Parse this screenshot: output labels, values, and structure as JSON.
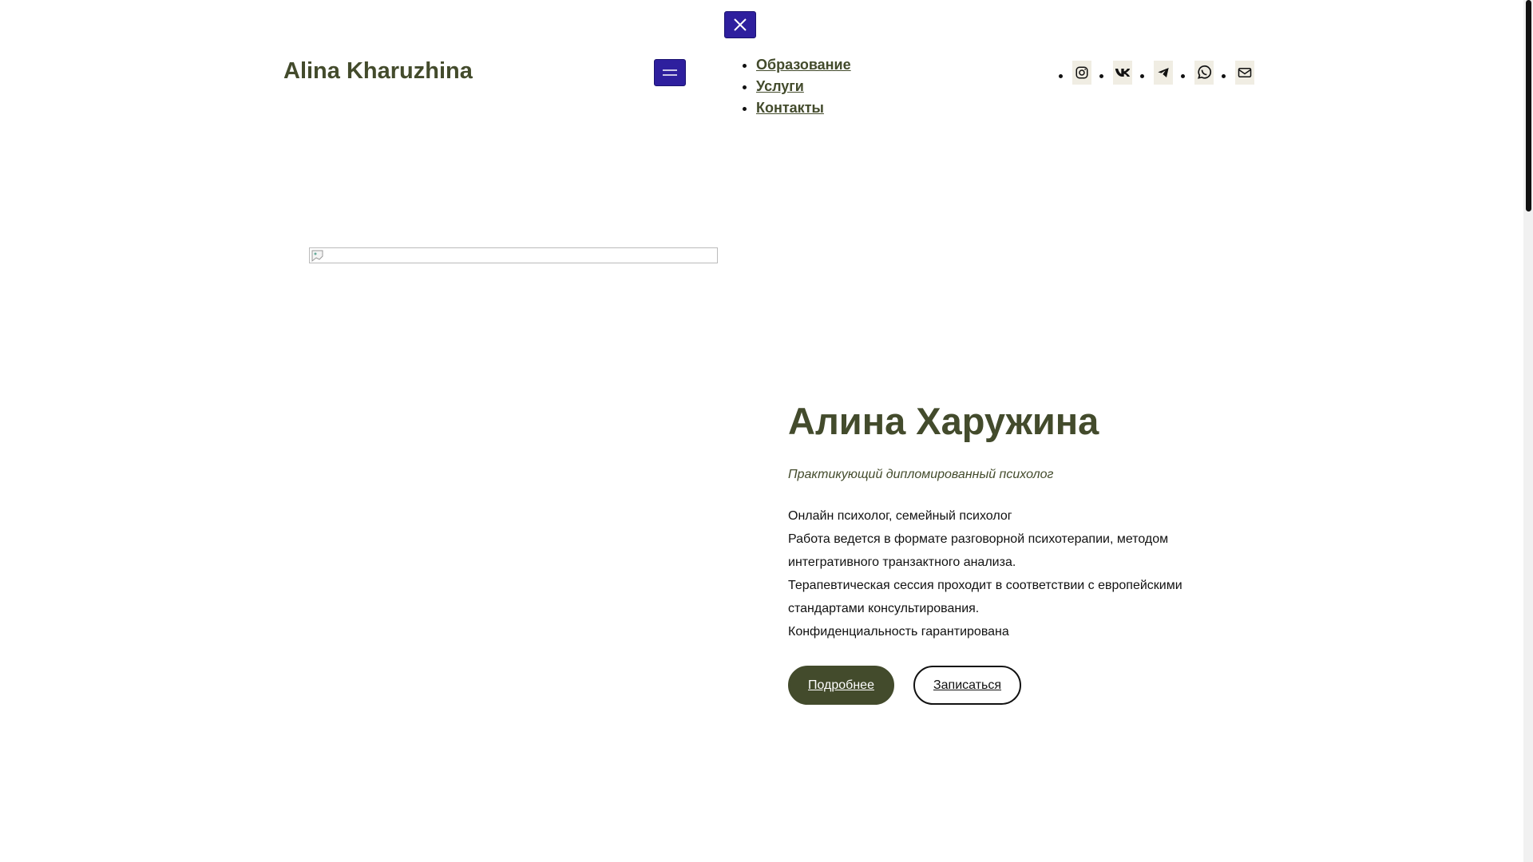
{
  "header": {
    "site_title": "Alina Kharuzhina",
    "close_icon": "close-icon",
    "menu_icon": "hamburger-menu-icon"
  },
  "nav": {
    "items": [
      {
        "label": "Образование"
      },
      {
        "label": "Услуги"
      },
      {
        "label": "Контакты"
      }
    ]
  },
  "social": {
    "items": [
      {
        "icon": "instagram-icon"
      },
      {
        "icon": "vk-icon"
      },
      {
        "icon": "telegram-icon"
      },
      {
        "icon": "whatsapp-icon"
      },
      {
        "icon": "mail-icon"
      }
    ]
  },
  "hero": {
    "name": "Алина Харужина",
    "subtitle": "Практикующий дипломированный психолог",
    "paragraphs": [
      "Онлайн психолог, семейный психолог",
      "Работа ведется в формате разговорной психотерапии, методом интегративного транзактного анализа.",
      "Терапевтическая сессия проходит в соответствии с европейскими стандартами консультирования.",
      "Конфиденциальность гарантирована"
    ],
    "primary_button": "Подробнее",
    "secondary_button": "Записаться"
  },
  "colors": {
    "accent": "#434b2c",
    "toggle_button": "#2e1f9e",
    "social_bg": "#f0ede3"
  }
}
